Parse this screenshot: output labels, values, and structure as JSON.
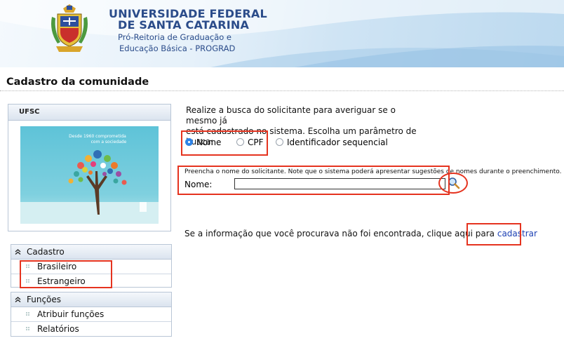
{
  "header": {
    "university_line1": "UNIVERSIDADE FEDERAL",
    "university_line2": "DE SANTA CATARINA",
    "department_line1": "Pró-Reitoria de Graduação e",
    "department_line2": "Educação Básica - PROGRAD"
  },
  "page": {
    "title": "Cadastro da comunidade"
  },
  "side_panel": {
    "title": "UFSC",
    "banner_text_line1": "Desde 1960 comprometida",
    "banner_text_line2": "com a sociedade"
  },
  "menus": {
    "cadastro": {
      "title": "Cadastro",
      "items": [
        "Brasileiro",
        "Estrangeiro"
      ]
    },
    "funcoes": {
      "title": "Funções",
      "items": [
        "Atribuir funções",
        "Relatórios"
      ]
    }
  },
  "search": {
    "intro_line1": "Realize a busca do solicitante para averiguar se o mesmo já",
    "intro_line2": "está cadastrado no sistema. Escolha um parâmetro de busca:",
    "options": [
      {
        "label": "Nome",
        "selected": true
      },
      {
        "label": "CPF",
        "selected": false
      },
      {
        "label": "Identificador sequencial",
        "selected": false
      }
    ],
    "hint": "Preencha o nome do solicitante. Note que o sistema poderá apresentar sugestões de nomes durante o preenchimento.",
    "field_label": "Nome:",
    "field_value": "",
    "button_icon": "magnifier-icon"
  },
  "footer_info": {
    "text": "Se a informação que você procurava não foi encontrada, clique aqui para ",
    "link": "cadastrar"
  },
  "colors": {
    "brand_blue": "#2b4c8a",
    "highlight_red": "#e5331f",
    "radio_selected": "#2f83e6",
    "link": "#1b3fb3"
  }
}
